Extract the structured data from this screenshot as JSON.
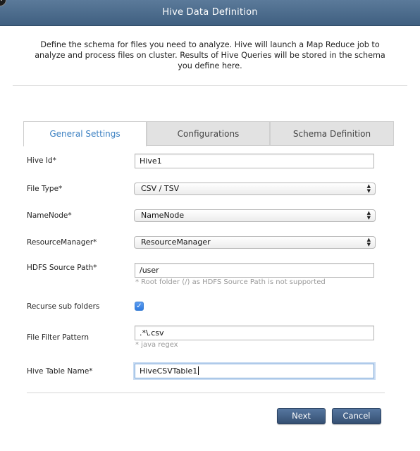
{
  "window": {
    "title": "Hive Data Definition",
    "close_symbol": "✕"
  },
  "description": "Define the schema for files you need to analyze. Hive will launch a Map Reduce job to analyze and process files on cluster. Results of Hive Queries will be stored in the schema you define here.",
  "tabs": [
    {
      "label": "General Settings",
      "active": true
    },
    {
      "label": "Configurations",
      "active": false
    },
    {
      "label": "Schema Definition",
      "active": false
    }
  ],
  "form": {
    "hive_id": {
      "label": "Hive Id*",
      "value": "Hive1"
    },
    "file_type": {
      "label": "File Type*",
      "value": "CSV / TSV"
    },
    "namenode": {
      "label": "NameNode*",
      "value": "NameNode"
    },
    "resource_manager": {
      "label": "ResourceManager*",
      "value": "ResourceManager"
    },
    "hdfs_source_path": {
      "label": "HDFS Source Path*",
      "value": "/user",
      "hint": "* Root folder (/) as HDFS Source Path is not supported"
    },
    "recurse_sub_folders": {
      "label": "Recurse sub folders",
      "checked": true,
      "check_symbol": "✓"
    },
    "file_filter_pattern": {
      "label": "File Filter Pattern",
      "value": ".*\\.csv",
      "hint": "* java regex"
    },
    "hive_table_name": {
      "label": "Hive Table Name*",
      "value": "HiveCSVTable1"
    }
  },
  "buttons": {
    "next": "Next",
    "cancel": "Cancel"
  },
  "colors": {
    "titlebar": "#4d6d8e",
    "active_tab_text": "#3a7fc1",
    "button": "#46648a"
  }
}
